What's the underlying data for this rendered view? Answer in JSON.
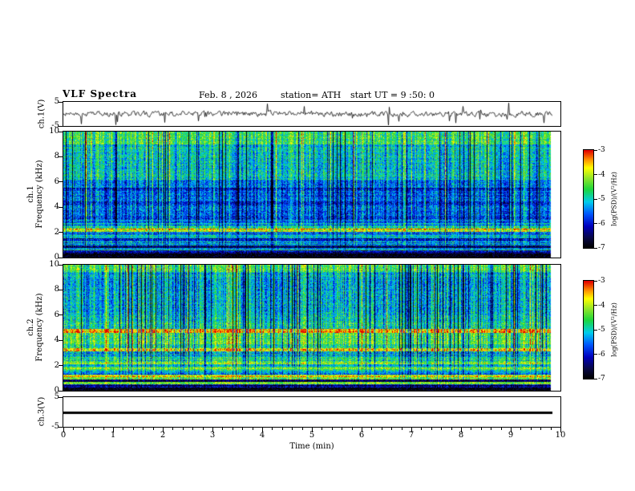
{
  "header": {
    "title": "VLF Spectra",
    "date_label": "Feb. 8 , 2026",
    "station_label": "station= ATH",
    "start_label": "start UT =  9 :50: 0"
  },
  "xaxis": {
    "label": "Time (min)",
    "ticks": [
      "0",
      "1",
      "2",
      "3",
      "4",
      "5",
      "6",
      "7",
      "8",
      "9",
      "10"
    ],
    "range": [
      0,
      10
    ]
  },
  "panels": {
    "ch1_wave": {
      "ylabel": "ch.1(V)",
      "yticks": [
        "5",
        "-5"
      ]
    },
    "ch1_spec": {
      "channel_label": "ch.1",
      "ylabel": "Frequency (kHz)",
      "yticks": [
        "10",
        "8",
        "6",
        "4",
        "2",
        "0"
      ]
    },
    "ch2_spec": {
      "channel_label": "ch.2",
      "ylabel": "Frequency (kHz)",
      "yticks": [
        "10",
        "8",
        "6",
        "4",
        "2",
        "0"
      ]
    },
    "ch3_wave": {
      "ylabel": "ch.3(V)",
      "yticks": [
        "5",
        "-5"
      ]
    }
  },
  "colorbar": {
    "label": "log(PSD)/(V²/Hz)",
    "ticks": [
      "-3",
      "-4",
      "-5",
      "-6",
      "-7"
    ],
    "stops": [
      {
        "t": 0.0,
        "rgb": [
          0,
          0,
          0
        ]
      },
      {
        "t": 0.1,
        "rgb": [
          8,
          8,
          70
        ]
      },
      {
        "t": 0.22,
        "rgb": [
          0,
          0,
          190
        ]
      },
      {
        "t": 0.35,
        "rgb": [
          0,
          90,
          255
        ]
      },
      {
        "t": 0.47,
        "rgb": [
          0,
          205,
          235
        ]
      },
      {
        "t": 0.6,
        "rgb": [
          30,
          215,
          60
        ]
      },
      {
        "t": 0.72,
        "rgb": [
          150,
          230,
          40
        ]
      },
      {
        "t": 0.82,
        "rgb": [
          255,
          255,
          0
        ]
      },
      {
        "t": 0.9,
        "rgb": [
          255,
          150,
          0
        ]
      },
      {
        "t": 1.0,
        "rgb": [
          225,
          0,
          0
        ]
      }
    ]
  },
  "chart_data": [
    {
      "type": "line",
      "name": "ch1-waveform",
      "ylabel": "ch.1(V)",
      "xlabel": "Time (min)",
      "xlim": [
        0,
        10
      ],
      "ylim": [
        -5,
        5
      ],
      "signal": "broadband noise around 0 V with frequent impulsive spikes over 0 to 9.8 min",
      "seed": 11
    },
    {
      "type": "heatmap",
      "name": "ch1-spectrogram",
      "ylabel": "Frequency (kHz)",
      "zlabel": "log(PSD)/(V²/Hz)",
      "xlim": [
        0,
        10
      ],
      "ylim": [
        0,
        10
      ],
      "zlim": [
        -7,
        -3
      ],
      "seed": 2026,
      "streakAmp": 1.0,
      "deepProb": 0.1,
      "deepAmp": 1.7,
      "noise": 1.1,
      "bands": [
        [
          0.0,
          0.3,
          -7.0
        ],
        [
          0.3,
          0.55,
          -6.2
        ],
        [
          0.55,
          0.75,
          -5.0
        ],
        [
          0.75,
          0.95,
          -6.8
        ],
        [
          0.95,
          1.3,
          -5.3
        ],
        [
          1.3,
          1.55,
          -5.8
        ],
        [
          1.55,
          1.8,
          -5.1
        ],
        [
          1.8,
          2.05,
          -5.6
        ],
        [
          2.05,
          2.3,
          -3.7
        ],
        [
          2.3,
          2.55,
          -5.0
        ],
        [
          2.55,
          3.0,
          -5.3
        ],
        [
          3.0,
          3.3,
          -5.9
        ],
        [
          3.3,
          4.2,
          -5.6
        ],
        [
          4.2,
          4.45,
          -6.0
        ],
        [
          4.45,
          5.3,
          -5.6
        ],
        [
          5.3,
          5.55,
          -6.0
        ],
        [
          5.55,
          6.2,
          -5.5
        ],
        [
          6.2,
          9.0,
          -5.05
        ],
        [
          9.0,
          10.01,
          -4.6
        ]
      ]
    },
    {
      "type": "heatmap",
      "name": "ch2-spectrogram",
      "ylabel": "Frequency (kHz)",
      "zlabel": "log(PSD)/(V²/Hz)",
      "xlim": [
        0,
        10
      ],
      "ylim": [
        0,
        10
      ],
      "zlim": [
        -7,
        -3
      ],
      "seed": 4097,
      "streakAmp": 1.15,
      "deepProb": 0.12,
      "deepAmp": 1.9,
      "noise": 1.1,
      "bands": [
        [
          0.0,
          0.28,
          -7.0
        ],
        [
          0.28,
          0.5,
          -6.5
        ],
        [
          0.5,
          0.7,
          -4.6
        ],
        [
          0.7,
          0.9,
          -6.6
        ],
        [
          0.9,
          1.1,
          -4.5
        ],
        [
          1.1,
          1.3,
          -3.6
        ],
        [
          1.3,
          1.6,
          -5.2
        ],
        [
          1.6,
          1.85,
          -4.4
        ],
        [
          1.85,
          2.1,
          -5.0
        ],
        [
          2.1,
          2.35,
          -4.0
        ],
        [
          2.35,
          2.8,
          -4.9
        ],
        [
          2.8,
          3.1,
          -5.1
        ],
        [
          3.1,
          3.35,
          -3.7
        ],
        [
          3.35,
          3.7,
          -4.7
        ],
        [
          3.7,
          4.1,
          -4.4
        ],
        [
          4.1,
          4.6,
          -4.5
        ],
        [
          4.6,
          4.9,
          -3.5
        ],
        [
          4.9,
          5.4,
          -4.8
        ],
        [
          5.4,
          6.0,
          -5.0
        ],
        [
          6.0,
          9.4,
          -5.15
        ],
        [
          9.4,
          10.01,
          -4.5
        ]
      ]
    },
    {
      "type": "line",
      "name": "ch3-waveform",
      "ylabel": "ch.3(V)",
      "xlim": [
        0,
        10
      ],
      "ylim": [
        -5,
        5
      ],
      "constant_value": 0,
      "signal": "flat line at 0 V (no signal on channel 3)"
    }
  ]
}
